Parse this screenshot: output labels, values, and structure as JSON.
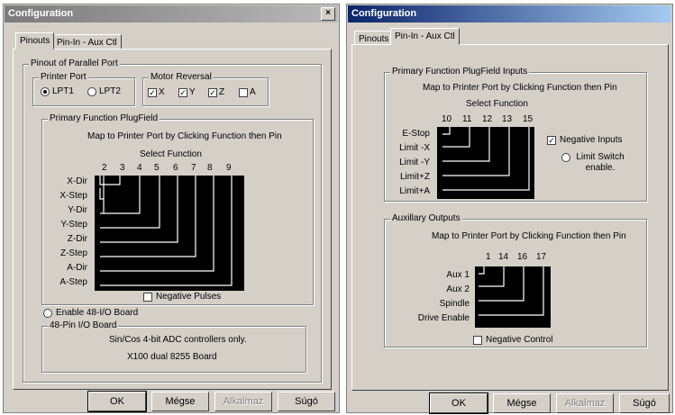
{
  "left_window": {
    "title": "Configuration",
    "close_glyph": "×",
    "tabs": [
      "Pinouts",
      "Pin-In - Aux Ctl"
    ],
    "pinout_group": "Pinout of Parallel Port",
    "printer_port": {
      "label": "Printer Port",
      "options": [
        "LPT1",
        "LPT2"
      ],
      "selected": "LPT1"
    },
    "motor_reversal": {
      "label": "Motor Reversal",
      "axes": [
        {
          "label": "X",
          "checked": true
        },
        {
          "label": "Y",
          "checked": true
        },
        {
          "label": "Z",
          "checked": true
        },
        {
          "label": "A",
          "checked": false
        }
      ]
    },
    "plugfield": {
      "label": "Primary Function PlugField",
      "instruction": "Map to Printer Port by Clicking Function then Pin",
      "select_function": "Select Function",
      "pins": [
        "2",
        "3",
        "4",
        "5",
        "6",
        "7",
        "8",
        "9"
      ],
      "functions": [
        "X-Dir",
        "X-Step",
        "Y-Dir",
        "Y-Step",
        "Z-Dir",
        "Z-Step",
        "A-Dir",
        "A-Step"
      ],
      "negative_pulses": {
        "label": "Negative Pulses",
        "checked": false
      }
    },
    "enable_48": "Enable 48-I/O Board",
    "board_group": "48-Pin I/O Board",
    "board_line1": "Sin/Cos 4-bit ADC controllers only.",
    "board_line2": "X100 dual 8255 Board",
    "buttons": {
      "ok": "OK",
      "cancel": "Mégse",
      "apply": "Alkalmaz",
      "help": "Súgó"
    }
  },
  "right_window": {
    "title": "Configuration",
    "tabs": [
      "Pinouts",
      "Pin-In - Aux Ctl"
    ],
    "inputs": {
      "label": "Primary Function PlugField Inputs",
      "instruction": "Map to Printer Port by Clicking Function then Pin",
      "select_function": "Select Function",
      "pins": [
        "10",
        "11",
        "12",
        "13",
        "15"
      ],
      "functions": [
        "E-Stop",
        "Limit -X",
        "Limit -Y",
        "Limit+Z",
        "Limit+A"
      ],
      "negative_inputs": {
        "label": "Negative Inputs",
        "checked": true
      },
      "limit_switch": "Limit Switch enable."
    },
    "outputs": {
      "label": "Auxillary Outputs",
      "instruction": "Map to Printer Port by Clicking Function then Pin",
      "pins": [
        "1",
        "14",
        "16",
        "17"
      ],
      "functions": [
        "Aux 1",
        "Aux 2",
        "Spindle",
        "Drive Enable"
      ],
      "negative_control": {
        "label": "Negative Control",
        "checked": false
      }
    },
    "buttons": {
      "ok": "OK",
      "cancel": "Mégse",
      "apply": "Alkalmaz",
      "help": "Súgó"
    }
  }
}
